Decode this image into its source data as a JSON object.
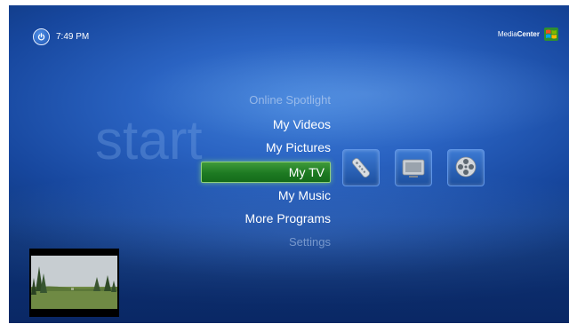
{
  "header": {
    "time": "7:49 PM",
    "brand_prefix": "Media",
    "brand_bold": "Center"
  },
  "watermark": "start",
  "menu": {
    "items": [
      {
        "label": "Online Spotlight"
      },
      {
        "label": "My Videos"
      },
      {
        "label": "My Pictures"
      },
      {
        "label": "My TV"
      },
      {
        "label": "My Music"
      },
      {
        "label": "More Programs"
      },
      {
        "label": "Settings"
      }
    ],
    "selected": "My TV"
  },
  "tiles": [
    {
      "icon": "remote-control-icon"
    },
    {
      "icon": "tv-monitor-icon"
    },
    {
      "icon": "film-reel-icon"
    }
  ],
  "colors": {
    "background": "#2a63c2",
    "selection": "#1d7a22",
    "text": "#ffffff"
  }
}
